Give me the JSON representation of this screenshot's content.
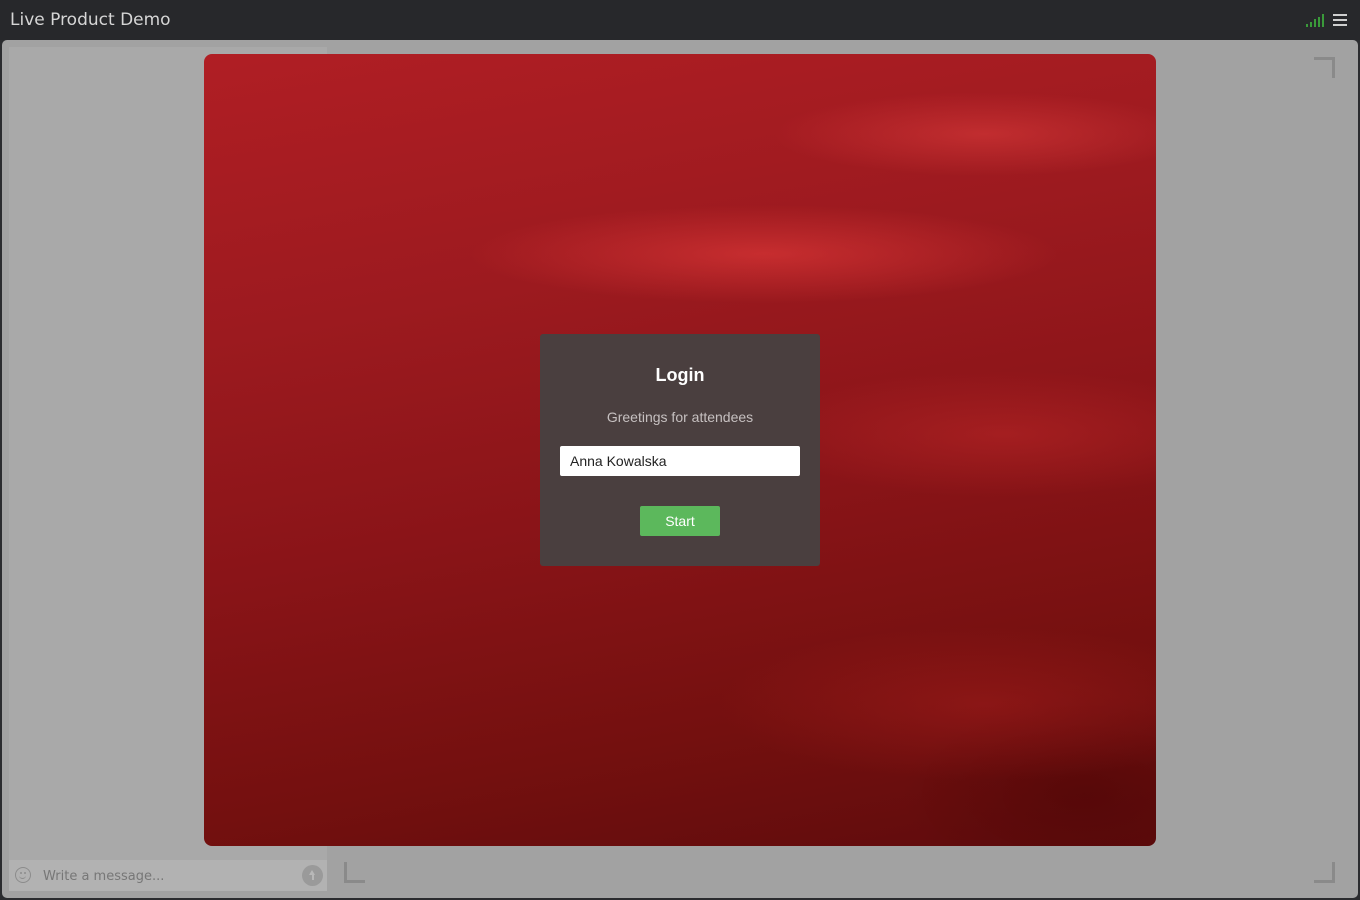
{
  "header": {
    "title": "Live Product Demo",
    "icons": [
      "signal-strength-icon",
      "hamburger-menu-icon"
    ]
  },
  "colors": {
    "topbar": "#27282b",
    "stage": "#a2a2a2",
    "video_background": "#9c1a1f",
    "dialog": "#4a3f3f",
    "start_button": "#5cb85c",
    "signal": "#3a9a3a"
  },
  "login": {
    "title": "Login",
    "subtitle": "Greetings for attendees",
    "name_value": "Anna Kowalska",
    "start_label": "Start"
  },
  "chat": {
    "placeholder": "Write a message...",
    "icons": [
      "smile-icon",
      "send-icon"
    ]
  }
}
